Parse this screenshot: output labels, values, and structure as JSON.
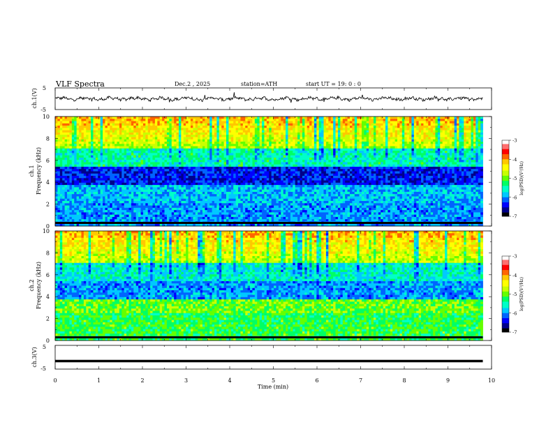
{
  "header": {
    "title": "VLF Spectra",
    "date": "Dec.2 , 2025",
    "station": "station=ATH",
    "start": "start UT = 19: 0 : 0"
  },
  "colors": {
    "colormap": [
      "#000000",
      "#00008b",
      "#0000ff",
      "#0064ff",
      "#00c8ff",
      "#00ffc8",
      "#00ff64",
      "#64ff00",
      "#c8ff00",
      "#ffff00",
      "#ffc800",
      "#ff6400",
      "#ff0000",
      "#ff6e6e",
      "#ffffff"
    ]
  },
  "chart_data": [
    {
      "type": "line",
      "ylabel": "ch.1(V)",
      "ylim": [
        -5,
        5
      ],
      "yticks": [
        "5",
        "-5"
      ],
      "note_series": "voltage waveform, mean about 0 V, amplitude about ±1 V with spikes"
    },
    {
      "type": "heatmap",
      "ylabel_channel": "ch.1",
      "ylabel": "Frequency (kHz)",
      "ylim": [
        0,
        10
      ],
      "yticks": [
        "0",
        "2",
        "4",
        "6",
        "8",
        "10"
      ],
      "colorbar": {
        "label": "log(PSD)(V²/Hz)",
        "range": [
          -7,
          -3
        ],
        "ticks": [
          "-3",
          "-4",
          "-5",
          "-6",
          "-7"
        ]
      }
    },
    {
      "type": "heatmap",
      "ylabel_channel": "ch.2",
      "ylabel": "Frequency (kHz)",
      "ylim": [
        0,
        10
      ],
      "yticks": [
        "0",
        "2",
        "4",
        "6",
        "8",
        "10"
      ],
      "colorbar": {
        "label": "log(PSD)(V²/Hz)",
        "range": [
          -7,
          -3
        ],
        "ticks": [
          "-3",
          "-4",
          "-5",
          "-6",
          "-7"
        ]
      }
    },
    {
      "type": "line",
      "ylabel": "ch.3(V)",
      "ylim": [
        -5,
        5
      ],
      "yticks": [
        "5",
        "-5"
      ],
      "note_series": "flat line at about -1.6 V",
      "level": -1.6
    }
  ],
  "xaxis": {
    "label": "Time (min)",
    "xlim": [
      0,
      10
    ],
    "ticks": [
      "0",
      "1",
      "2",
      "3",
      "4",
      "5",
      "6",
      "7",
      "8",
      "9",
      "10"
    ]
  }
}
